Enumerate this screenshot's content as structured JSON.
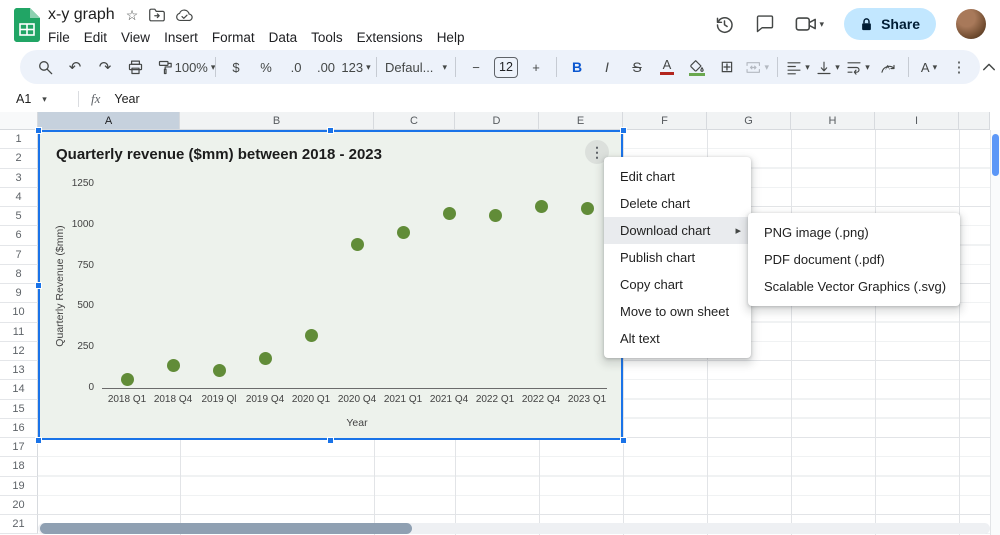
{
  "app": {
    "title": "x-y graph",
    "menu": [
      "File",
      "Edit",
      "View",
      "Insert",
      "Format",
      "Data",
      "Tools",
      "Extensions",
      "Help"
    ],
    "share_label": "Share"
  },
  "toolbar": {
    "zoom": "100%",
    "currency": "$",
    "percent": "%",
    "decrease_decimals": ".0",
    "increase_decimals": ".00",
    "number_format": "123",
    "font": "Defaul...",
    "decrease_font": "−",
    "font_size": "12",
    "increase_font": "+",
    "bold": "B",
    "italic": "I",
    "strikethrough": "S",
    "text_color": "A",
    "text_style": "A",
    "more": "⋮",
    "borders_glyph": "⊞"
  },
  "formula_bar": {
    "cell_ref": "A1",
    "fx_label": "fx",
    "value": "Year"
  },
  "grid": {
    "columns": [
      "A",
      "B",
      "C",
      "D",
      "E",
      "F",
      "G",
      "H",
      "I"
    ],
    "rows": [
      "1",
      "2",
      "3",
      "4",
      "5",
      "6",
      "7",
      "8",
      "9",
      "10",
      "11",
      "12",
      "13",
      "14",
      "15",
      "16",
      "17",
      "18",
      "19",
      "20",
      "21"
    ]
  },
  "chart_data": {
    "type": "scatter",
    "title": "Quarterly revenue ($mm) between 2018 - 2023",
    "xlabel": "Year",
    "ylabel": "Quarterly Revenue ($mm)",
    "categories": [
      "2018 Q1",
      "2018 Q4",
      "2019 Ql",
      "2019 Q4",
      "2020 Q1",
      "2020 Q4",
      "2021 Q1",
      "2021 Q4",
      "2022 Q1",
      "2022 Q4",
      "2023 Q1"
    ],
    "values": [
      50,
      140,
      110,
      180,
      320,
      880,
      950,
      1070,
      1060,
      1110,
      1100
    ],
    "yticks": [
      0,
      250,
      500,
      750,
      1000,
      1250
    ],
    "ylim": [
      0,
      1250
    ],
    "grid": "off",
    "legend": "none",
    "point_color": "#618c38"
  },
  "context_menu": {
    "items": [
      {
        "label": "Edit chart"
      },
      {
        "label": "Delete chart"
      },
      {
        "label": "Download chart",
        "highlighted": true,
        "has_submenu": true
      },
      {
        "label": "Publish chart"
      },
      {
        "label": "Copy chart"
      },
      {
        "label": "Move to own sheet"
      },
      {
        "label": "Alt text"
      }
    ]
  },
  "download_submenu": {
    "items": [
      "PNG image (.png)",
      "PDF document (.pdf)",
      "Scalable Vector Graphics (.svg)"
    ]
  },
  "colors": {
    "accent_blue": "#0b57d0",
    "selection_blue": "#1a73e8",
    "share_bg": "#c2e7ff",
    "toolbar_bg": "#edf2fa",
    "chart_bg_tint": "#edf2ec",
    "chart_point": "#618c38",
    "fill_color_swatch": "#6aa84f",
    "text_color_swatch": "#b3261e"
  }
}
